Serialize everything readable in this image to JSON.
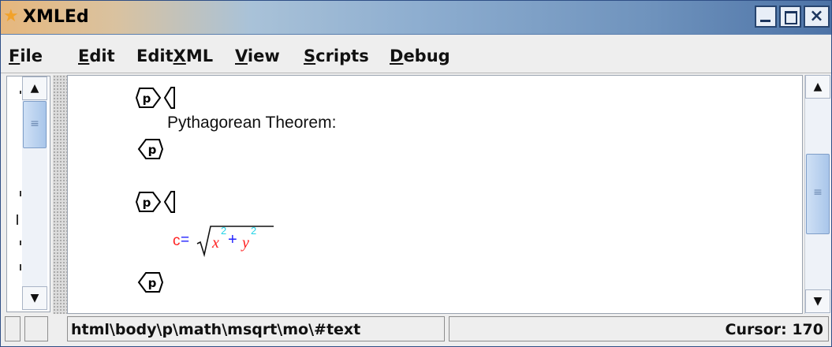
{
  "app": {
    "title": "XMLEd",
    "colors": {
      "titlebar_start": "#e6b77d",
      "titlebar_end": "#4c72a6",
      "math_red": "#ff2020",
      "math_blue": "#2222ff",
      "math_cyan": "#22d3e6"
    }
  },
  "window_controls": {
    "minimize": "minimize-icon",
    "maximize": "maximize-icon",
    "close": "close-icon"
  },
  "menu": [
    {
      "pre": "",
      "u": "F",
      "post": "ile"
    },
    {
      "pre": "",
      "u": "E",
      "post": "dit"
    },
    {
      "pre": "Edit",
      "u": "X",
      "post": "ML"
    },
    {
      "pre": "",
      "u": "V",
      "post": "iew"
    },
    {
      "pre": "",
      "u": "S",
      "post": "cripts"
    },
    {
      "pre": "",
      "u": "D",
      "post": "ebug"
    }
  ],
  "document": {
    "tag_name": "p",
    "paragraph1_text": "Pythagorean Theorem:",
    "math": {
      "lhs": "c",
      "eq": "=",
      "x": "x",
      "plus": "+",
      "y": "y",
      "exp": "2"
    }
  },
  "status": {
    "path": "html\\body\\p\\math\\msqrt\\mo\\#text",
    "cursor": "Cursor: 170"
  }
}
